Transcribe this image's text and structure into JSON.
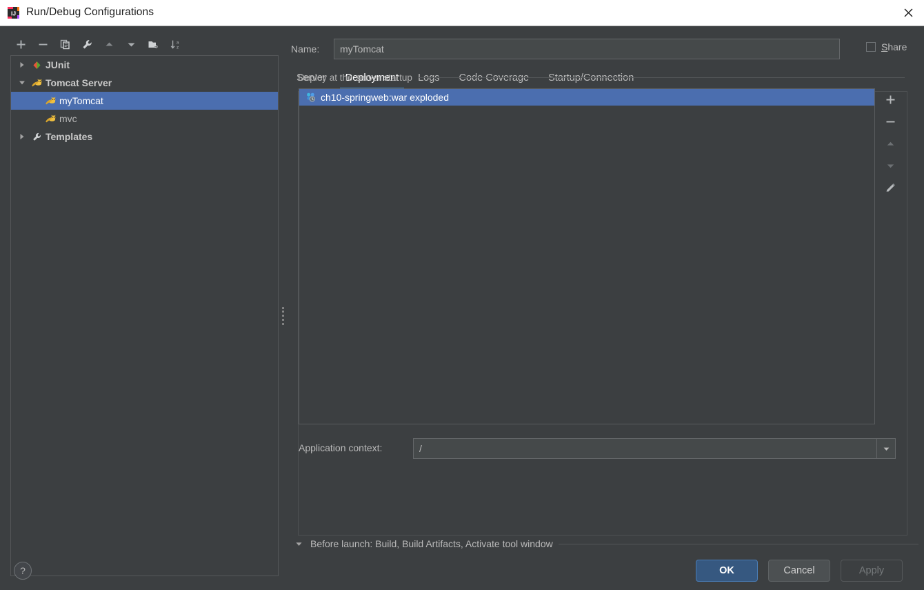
{
  "window": {
    "title": "Run/Debug Configurations",
    "app_icon": "intellij-idea-logo-icon",
    "close_icon": "close-icon"
  },
  "left_toolbar": {
    "buttons": [
      {
        "name": "add-configuration",
        "icon": "plus-icon",
        "label": "+"
      },
      {
        "name": "remove-configuration",
        "icon": "minus-icon",
        "label": "−"
      },
      {
        "name": "copy-configuration",
        "icon": "copy-icon",
        "label": "Copy"
      },
      {
        "name": "edit-templates",
        "icon": "wrench-icon",
        "label": "Edit defaults"
      },
      {
        "name": "move-up",
        "icon": "arrow-up-icon",
        "label": "Move Up"
      },
      {
        "name": "move-down",
        "icon": "arrow-down-icon",
        "label": "Move Down"
      },
      {
        "name": "new-folder",
        "icon": "folder-add-icon",
        "label": "New Folder"
      },
      {
        "name": "sort-alphabetically",
        "icon": "sort-az-icon",
        "label": "Sort Configurations"
      }
    ]
  },
  "tree": {
    "nodes": [
      {
        "label": "JUnit",
        "icon": "junit-icon",
        "twisty": "collapsed",
        "level": 0,
        "selected": false
      },
      {
        "label": "Tomcat Server",
        "icon": "tomcat-icon",
        "twisty": "expanded",
        "level": 0,
        "selected": false
      },
      {
        "label": "myTomcat",
        "icon": "tomcat-icon",
        "twisty": "none",
        "level": 1,
        "selected": true
      },
      {
        "label": "mvc",
        "icon": "tomcat-icon",
        "twisty": "none",
        "level": 1,
        "selected": false
      },
      {
        "label": "Templates",
        "icon": "wrench-icon",
        "twisty": "collapsed",
        "level": 0,
        "selected": false
      }
    ]
  },
  "splitter": {
    "name": "panel-splitter"
  },
  "form": {
    "name_label": "Name:",
    "name_value": "myTomcat",
    "name_placeholder": "",
    "share_label_prefix": "",
    "share_mnemonic": "S",
    "share_label_rest": "hare",
    "share_checked": false
  },
  "tabs": {
    "items": [
      {
        "label": "Server",
        "active": false
      },
      {
        "label": "Deployment",
        "active": true
      },
      {
        "label": "Logs",
        "active": false
      },
      {
        "label": "Code Coverage",
        "active": false
      },
      {
        "label": "Startup/Connection",
        "active": false
      }
    ]
  },
  "deployment": {
    "group_label": "Deploy at the server startup",
    "items": [
      {
        "label": "ch10-springweb:war exploded",
        "icon": "artifact-icon",
        "selected": true
      }
    ],
    "list_toolbar": [
      {
        "name": "add-artifact",
        "icon": "plus-icon",
        "enabled": true
      },
      {
        "name": "remove-artifact",
        "icon": "minus-icon",
        "enabled": true
      },
      {
        "name": "move-artifact-up",
        "icon": "triangle-up-icon",
        "enabled": false
      },
      {
        "name": "move-artifact-down",
        "icon": "triangle-down-icon",
        "enabled": false
      },
      {
        "name": "edit-artifact",
        "icon": "pencil-icon",
        "enabled": true
      }
    ],
    "app_context_label": "Application context:",
    "app_context_value": "/",
    "app_context_dropdown_icon": "chevron-down-icon"
  },
  "before_launch": {
    "twisty": "expanded",
    "text": "Before launch: Build, Build Artifacts, Activate tool window"
  },
  "footer": {
    "help_label": "?",
    "ok_label": "OK",
    "cancel_label": "Cancel",
    "apply_label": "Apply",
    "apply_enabled": false
  },
  "colors": {
    "window_bg": "#3c3f41",
    "titlebar_bg": "#ffffff",
    "selection_blue": "#4b6eaf",
    "tab_underline": "#4a88c7",
    "ok_button": "#365880",
    "text": "#bbbbbb"
  }
}
